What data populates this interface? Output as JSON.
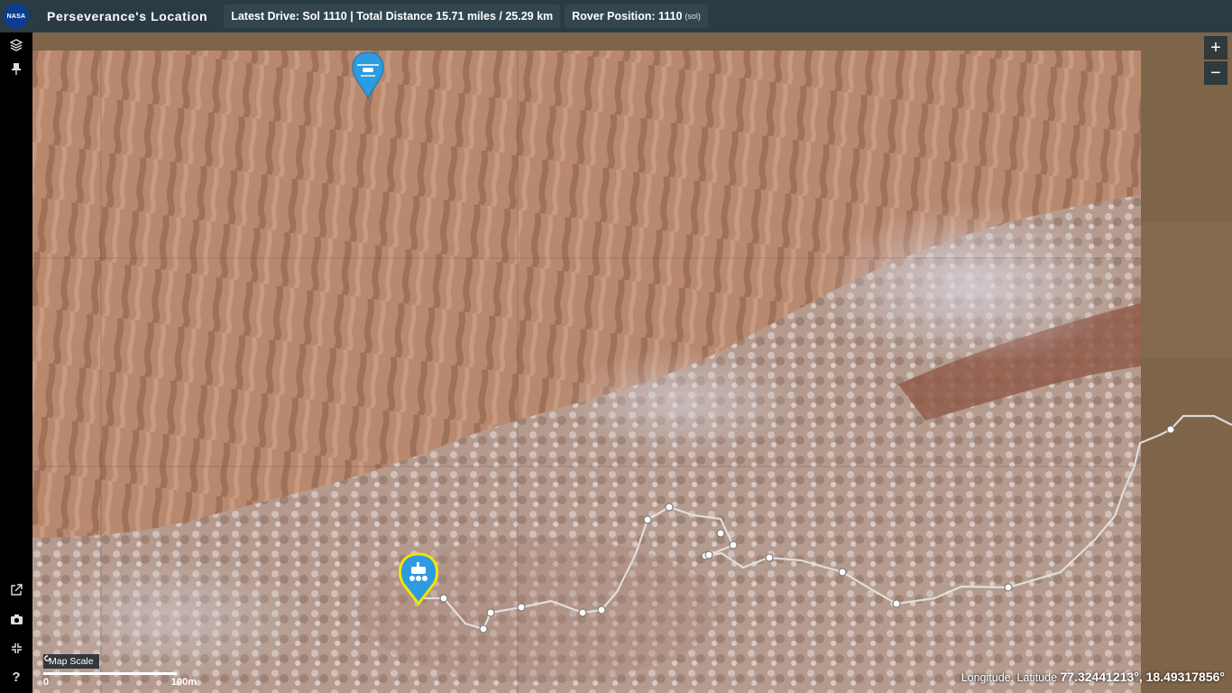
{
  "header": {
    "logo_text": "NASA",
    "title": "Perseverance's Location",
    "latest_drive": "Latest Drive: Sol 1110 | Total Distance 15.71 miles / 25.29 km",
    "rover_position_label": "Rover Position: 1110",
    "rover_position_unit": "(sol)"
  },
  "left_rail": {
    "items": [
      "layers-icon",
      "pin-icon"
    ],
    "bottom_items": [
      "external-link-icon",
      "camera-icon",
      "collapse-icon",
      "help-icon"
    ]
  },
  "map": {
    "zoom_in": "+",
    "zoom_out": "−",
    "scale_label": "Map Scale",
    "scale_start": "0",
    "scale_end": "100m",
    "coords_label": "Longitude, Latitude",
    "coords_value": "77.32441213°, 18.49317856°",
    "markers": [
      "helicopter-marker",
      "rover-marker"
    ],
    "colors": {
      "marker_blue": "#2d9be0",
      "rover_highlight": "#f3e600",
      "traverse_line": "#e6e6e6"
    }
  }
}
